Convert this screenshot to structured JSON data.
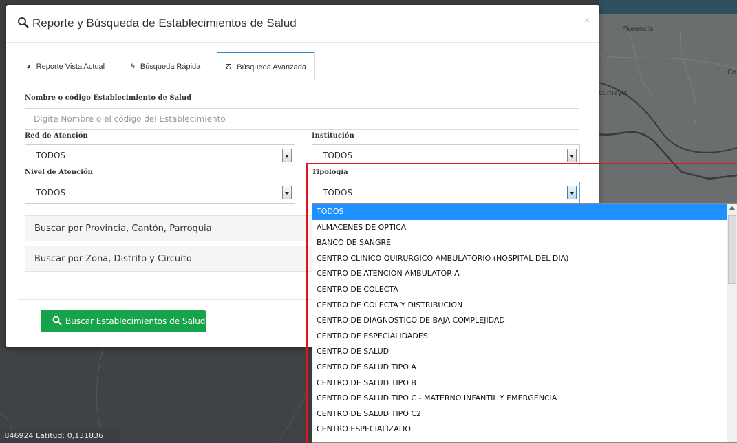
{
  "map": {
    "labels": [
      "Florencia",
      "Co",
      "cumayo"
    ],
    "coordinates": ",846924 Latitud: 0,131836"
  },
  "modal": {
    "title": "Reporte y Búsqueda de Establecimientos de Salud",
    "close": "×",
    "tabs": [
      {
        "label": "Reporte Vista Actual",
        "icon": "globe-icon",
        "active": false
      },
      {
        "label": "Búsqueda Rápida",
        "icon": "bolt-icon",
        "active": false
      },
      {
        "label": "Búsqueda Avanzada",
        "icon": "filter-icon",
        "active": true
      }
    ],
    "name_field": {
      "label": "Nombre o código Establecimiento de Salud",
      "placeholder": "Digite Nombre o el código del Establecimiento"
    },
    "red": {
      "label": "Red de Atención",
      "value": "TODOS"
    },
    "institucion": {
      "label": "Institución",
      "value": "TODOS"
    },
    "nivel": {
      "label": "Nivel de Atención",
      "value": "TODOS"
    },
    "tipologia": {
      "label": "Tipología",
      "value": "TODOS"
    },
    "accordions": [
      "Buscar por Provincia, Cantón, Parroquia",
      "Buscar por Zona, Distrito y Circuito"
    ],
    "search_button": "Buscar Establecimientos de Salud"
  },
  "tipologia_options": [
    "TODOS",
    "ALMACENES DE OPTICA",
    "BANCO DE SANGRE",
    "CENTRO CLINICO QUIRURGICO AMBULATORIO (HOSPITAL DEL DIA)",
    "CENTRO DE ATENCION AMBULATORIA",
    "CENTRO DE COLECTA",
    "CENTRO DE COLECTA Y DISTRIBUCION",
    "CENTRO DE DIAGNOSTICO DE BAJA COMPLEJIDAD",
    "CENTRO DE ESPECIALIDADES",
    "CENTRO DE SALUD",
    "CENTRO DE SALUD TIPO A",
    "CENTRO DE SALUD TIPO B",
    "CENTRO DE SALUD TIPO C - MATERNO INFANTIL Y EMERGENCIA",
    "CENTRO DE SALUD TIPO C2",
    "CENTRO ESPECIALIZADO"
  ],
  "colors": {
    "accent": "#2a8bc0",
    "button": "#16a34a",
    "selected": "#1e90ff",
    "highlight_box": "#e1141d"
  }
}
